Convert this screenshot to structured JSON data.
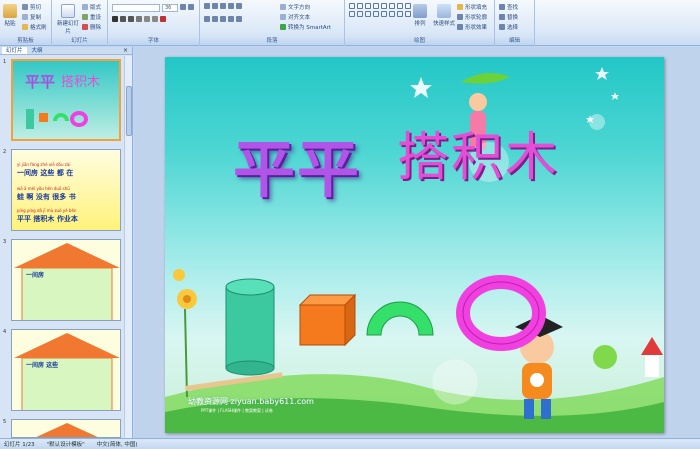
{
  "ribbon": {
    "clipboard": {
      "label": "剪贴板",
      "paste": "粘贴",
      "cut": "剪切",
      "copy": "复制",
      "format_painter": "格式刷"
    },
    "slides": {
      "label": "幻灯片",
      "new_slide": "新建幻灯片",
      "layout": "版式",
      "reset": "重设",
      "delete": "删除"
    },
    "font": {
      "label": "字体",
      "font_size": "36"
    },
    "paragraph": {
      "label": "段落",
      "text_direction": "文字方向",
      "align_text": "对齐文本",
      "smartart": "转换为 SmartArt"
    },
    "drawing": {
      "label": "绘图",
      "arrange": "排列",
      "quick_styles": "快速样式",
      "shape_fill": "形状填充",
      "shape_outline": "形状轮廓",
      "shape_effects": "形状效果"
    },
    "editing": {
      "label": "编辑",
      "find": "查找",
      "replace": "替换",
      "select": "选择"
    }
  },
  "panel": {
    "tabs": [
      "幻灯片",
      "大纲"
    ],
    "close": "×",
    "slides": [
      {
        "num": "1"
      },
      {
        "num": "2",
        "pinyin1": "yì jiān fáng   zhè xiē   dōu   zài",
        "line1": "一间房   这些   都   在",
        "pinyin2": "wā  ā    méi yǒu  hěn duō  shū",
        "line2": "蛙  啊   没有   很多   书",
        "pinyin3": "píng píng  dā jī mù  zuò yè běn",
        "line3": "平平   搭积木   作业本"
      },
      {
        "num": "3",
        "label": "一间房"
      },
      {
        "num": "4",
        "label": "一间房  这些"
      },
      {
        "num": "5"
      }
    ]
  },
  "slide": {
    "title_left": "平平",
    "title_right": "搭积木",
    "site_name": "幼教资源网 ziyuan.baby611.com",
    "site_sub": "PPT课件 | FLASH课件 | 教案教案 | 试卷"
  },
  "statusbar": {
    "slide_info": "幻灯片 1/23",
    "theme": "\"默认设计模板\"",
    "language": "中文(简体, 中国)"
  },
  "colors": {
    "purple_title": "#b055e8",
    "magenta_title": "#e24fd6",
    "cylinder": "#3cc9a0",
    "cube": "#f57a1e",
    "arch": "#35e06a",
    "ring": "#f040e0"
  }
}
